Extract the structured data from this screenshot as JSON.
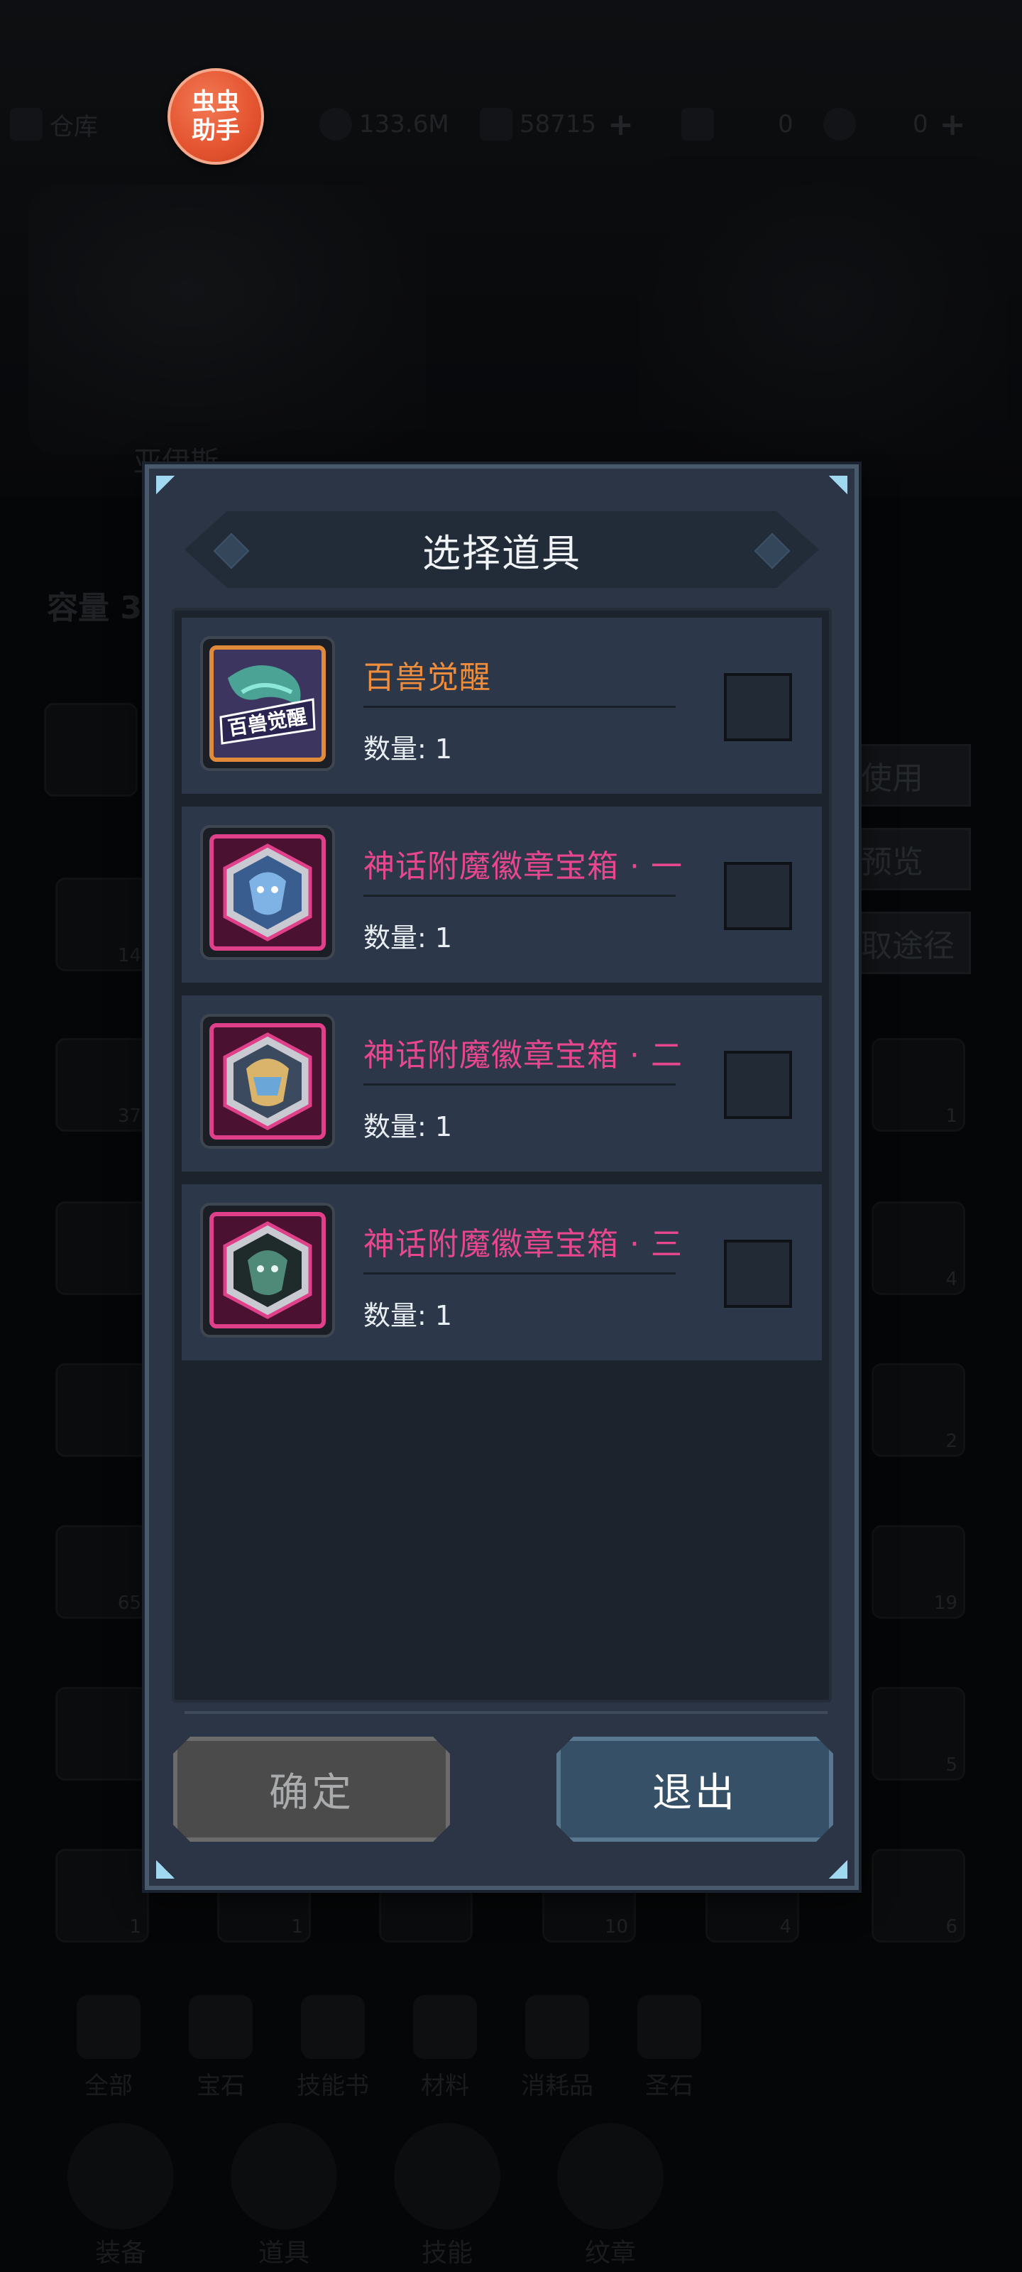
{
  "helper_badge": {
    "line1": "虫虫",
    "line2": "助手"
  },
  "background": {
    "topbar": {
      "warehouse_label": "仓库",
      "coins": "133.6M",
      "gems": "58715",
      "count_a": "0",
      "count_b": "0"
    },
    "hero_name": "亚伊斯",
    "capacity_label": "容量 3",
    "side_buttons": [
      "使用",
      "预览",
      "取途径"
    ],
    "cell_numbers": [
      "14",
      "37",
      "1",
      "4",
      "2",
      "65",
      "19",
      "5",
      "1",
      "1",
      "10",
      "4",
      "6"
    ],
    "category_tabs": [
      "全部",
      "宝石",
      "技能书",
      "材料",
      "消耗品",
      "圣石"
    ],
    "bottom_nav": [
      "装备",
      "道具",
      "技能",
      "纹章"
    ]
  },
  "dialog": {
    "title": "选择道具",
    "items": [
      {
        "name": "百兽觉醒",
        "quantity": "数量: 1",
        "name_color": "#ee8d3c",
        "icon_text": "百兽觉醒",
        "checked": false
      },
      {
        "name": "神话附魔徽章宝箱 · 一",
        "quantity": "数量: 1",
        "name_color": "#e8478e",
        "checked": false
      },
      {
        "name": "神话附魔徽章宝箱 · 二",
        "quantity": "数量: 1",
        "name_color": "#e8478e",
        "checked": false
      },
      {
        "name": "神话附魔徽章宝箱 · 三",
        "quantity": "数量: 1",
        "name_color": "#e8478e",
        "checked": false
      }
    ],
    "confirm_label": "确定",
    "exit_label": "退出"
  }
}
